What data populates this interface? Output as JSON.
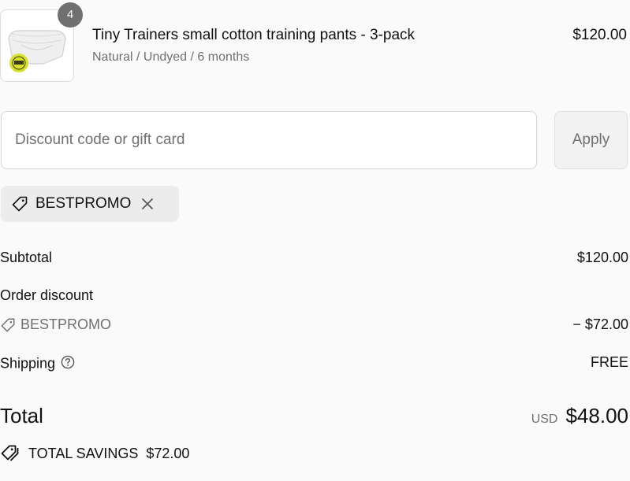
{
  "product": {
    "quantity": "4",
    "title": "Tiny Trainers small cotton training pants - 3-pack",
    "variant": "Natural / Undyed / 6 months",
    "price": "$120.00",
    "image_icon": "training-pants-image"
  },
  "discount": {
    "placeholder": "Discount code or gift card",
    "apply_label": "Apply",
    "applied_code": "BESTPROMO"
  },
  "summary": {
    "subtotal_label": "Subtotal",
    "subtotal_value": "$120.00",
    "order_discount_label": "Order discount",
    "discount_code": "BESTPROMO",
    "discount_value": "− $72.00",
    "shipping_label": "Shipping",
    "shipping_value": "FREE",
    "total_label": "Total",
    "currency": "USD",
    "total_value": "$48.00",
    "savings_label": "TOTAL SAVINGS",
    "savings_value": "$72.00"
  },
  "colors": {
    "background": "#fafafa",
    "muted_text": "#707070",
    "badge": "#707070",
    "tag_background": "#ececec"
  }
}
